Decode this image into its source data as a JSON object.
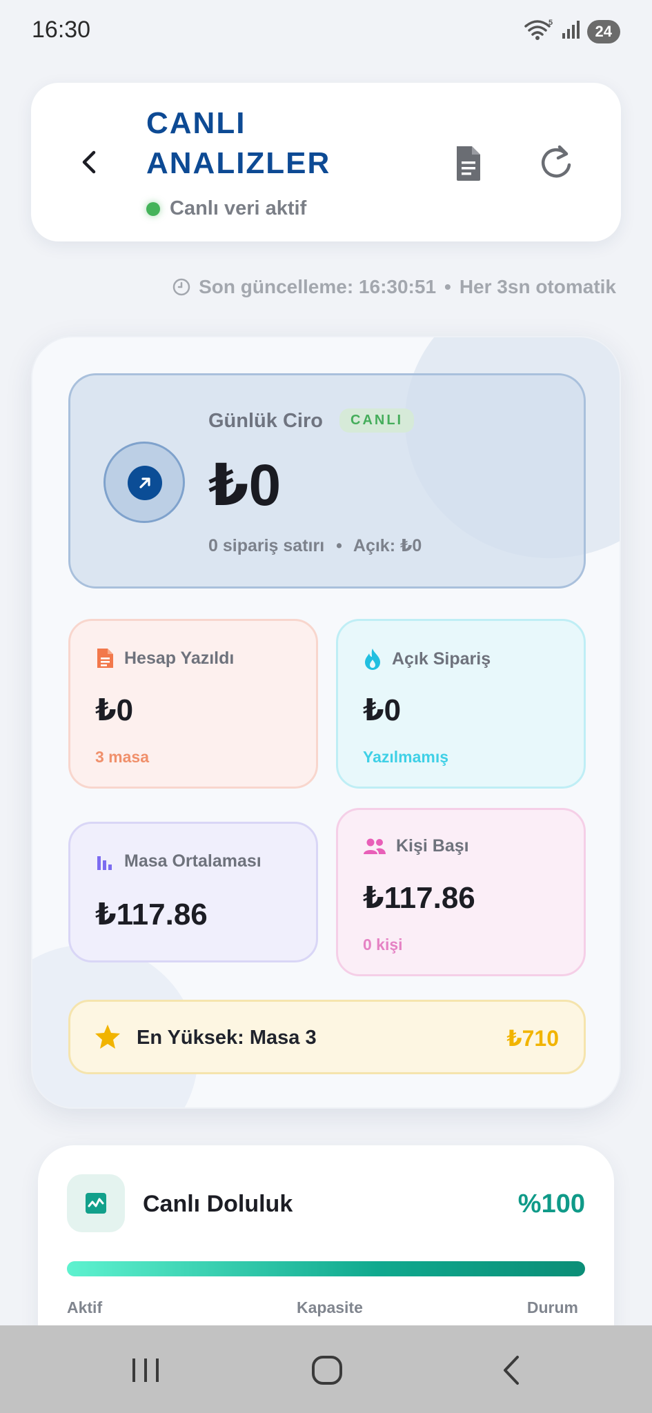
{
  "status_bar": {
    "time": "16:30",
    "wifi_badge": "5",
    "battery": "24"
  },
  "header": {
    "title": "CANLI ANALIZLER",
    "live_status": "Canlı veri aktif"
  },
  "update_info": {
    "last_update": "Son güncelleme: 16:30:51",
    "separator": "•",
    "auto_refresh": "Her 3sn otomatik"
  },
  "daily_revenue": {
    "title": "Günlük Ciro",
    "badge": "CANLI",
    "value": "₺0",
    "orders": "0 sipariş satırı",
    "separator": "•",
    "open": "Açık: ₺0"
  },
  "stats": {
    "billed": {
      "label": "Hesap Yazıldı",
      "value": "₺0",
      "sub": "3 masa",
      "sub_color": "#f0906b"
    },
    "open_orders": {
      "label": "Açık Sipariş",
      "value": "₺0",
      "sub": "Yazılmamış",
      "sub_color": "#3fd0e6"
    },
    "table_avg": {
      "label": "Masa Ortalaması",
      "value": "₺117.86"
    },
    "per_person": {
      "label": "Kişi Başı",
      "value": "₺117.86",
      "sub": "0 kişi",
      "sub_color": "#e582c4"
    }
  },
  "top_table": {
    "label": "En Yüksek: Masa 3",
    "value": "₺710"
  },
  "occupancy": {
    "title": "Canlı Doluluk",
    "percent_label": "%100",
    "fill_fraction": 1.0,
    "columns": [
      "Aktif",
      "Kapasite",
      "Durum"
    ]
  },
  "colors": {
    "accent_blue": "#0d4a94",
    "live_green": "#44b35a",
    "teal": "#0f9a88",
    "gold": "#f1b400"
  }
}
